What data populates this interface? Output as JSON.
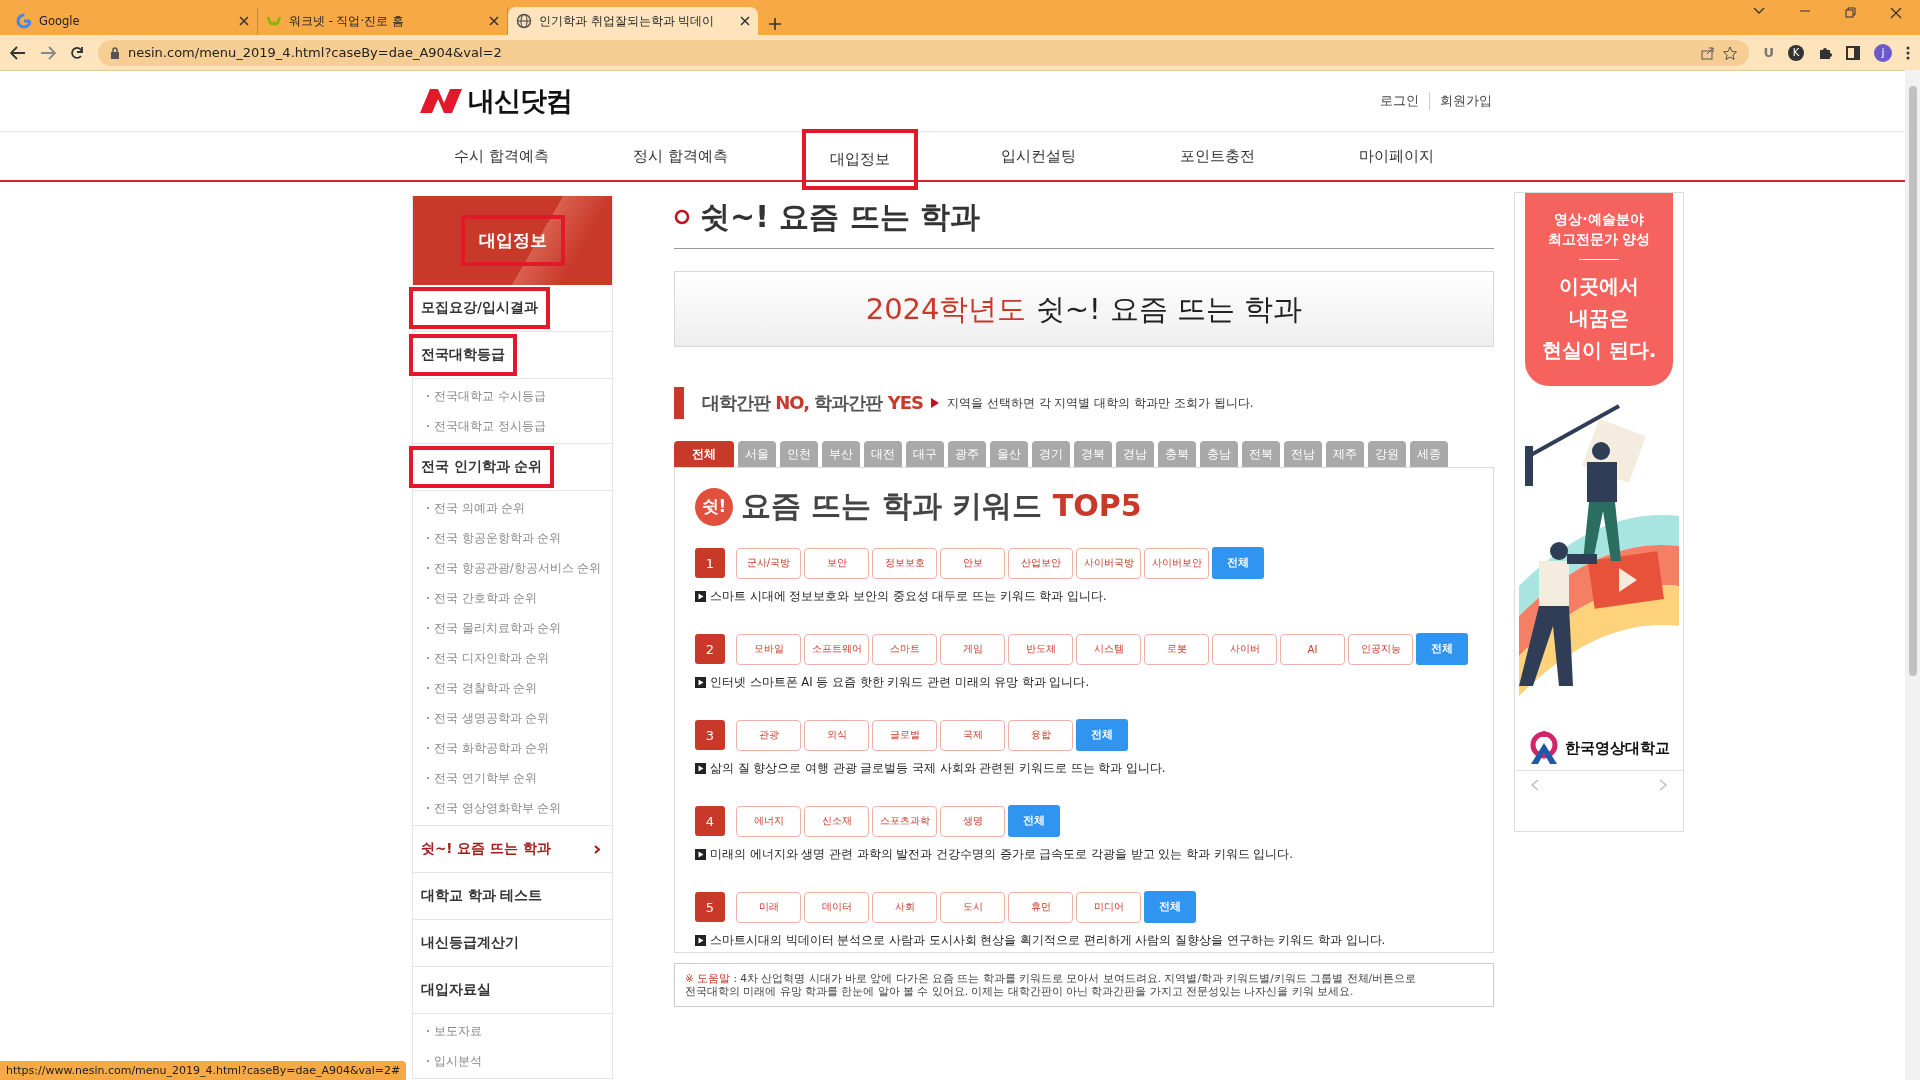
{
  "browser": {
    "tabs": [
      {
        "title": "Google",
        "kind": "google",
        "selected": false
      },
      {
        "title": "워크넷 - 직업·진로 홈",
        "kind": "leaf",
        "selected": false
      },
      {
        "title": "인기학과 취업잘되는학과 빅데이",
        "kind": "globe",
        "selected": true
      }
    ],
    "url": "nesin.com/menu_2019_4.html?caseBy=dae_A904&val=2",
    "extensions": [
      "U",
      "K"
    ],
    "profile": "j"
  },
  "header": {
    "logo": "내신닷컴",
    "links": [
      "로그인",
      "회원가입"
    ],
    "nav": [
      {
        "label": "수시 합격예측",
        "highlighted": false
      },
      {
        "label": "정시 합격예측",
        "highlighted": false
      },
      {
        "label": "대입정보",
        "highlighted": true
      },
      {
        "label": "입시컨설팅",
        "highlighted": false
      },
      {
        "label": "포인트충전",
        "highlighted": false
      },
      {
        "label": "마이페이지",
        "highlighted": false
      }
    ]
  },
  "sidebar": {
    "title": "대입정보",
    "title_highlighted": true,
    "items": [
      {
        "kind": "main",
        "label": "모집요강/입시결과",
        "highlighted": true,
        "selected": false
      },
      {
        "kind": "main",
        "label": "전국대학등급",
        "highlighted": true,
        "selected": false,
        "children": [
          {
            "label": "전국대학교 수시등급"
          },
          {
            "label": "전국대학교 정시등급"
          }
        ]
      },
      {
        "kind": "main",
        "label": "전국 인기학과 순위",
        "highlighted": true,
        "selected": false,
        "children": [
          {
            "label": "전국 의예과 순위"
          },
          {
            "label": "전국 항공운항학과 순위"
          },
          {
            "label": "전국 항공관광/항공서비스 순위"
          },
          {
            "label": "전국 간호학과 순위"
          },
          {
            "label": "전국 물리치료학과 순위"
          },
          {
            "label": "전국 디자인학과 순위"
          },
          {
            "label": "전국 경찰학과 순위"
          },
          {
            "label": "전국 생명공학과 순위"
          },
          {
            "label": "전국 화학공학과 순위"
          },
          {
            "label": "전국 연기학부 순위"
          },
          {
            "label": "전국 영상영화학부 순위"
          }
        ]
      },
      {
        "kind": "main",
        "label": "쉿~! 요즘 뜨는 학과",
        "highlighted": false,
        "selected": true
      },
      {
        "kind": "main",
        "label": "대학교 학과 테스트",
        "highlighted": false,
        "selected": false
      },
      {
        "kind": "main",
        "label": "내신등급계산기",
        "highlighted": false,
        "selected": false
      },
      {
        "kind": "main",
        "label": "대입자료실",
        "highlighted": false,
        "selected": false,
        "children": [
          {
            "label": "보도자료"
          },
          {
            "label": "입시분석"
          }
        ]
      }
    ]
  },
  "main": {
    "title": "쉿~! 요즘 뜨는 학과",
    "banner": {
      "year": "2024학년도",
      "text": "쉿~! 요즘 뜨는 학과"
    },
    "slogan": [
      {
        "text": "대학간판 ",
        "accent": false
      },
      {
        "text": "NO,",
        "accent": true
      },
      {
        "text": " 학과간판 ",
        "accent": false
      },
      {
        "text": "YES",
        "accent": true
      }
    ],
    "slogan_hint": "지역을 선택하면 각 지역별 대학의 학과만 조회가 됩니다.",
    "regions": [
      {
        "label": "전체",
        "selected": true
      },
      {
        "label": "서울",
        "selected": false
      },
      {
        "label": "인천",
        "selected": false
      },
      {
        "label": "부산",
        "selected": false
      },
      {
        "label": "대전",
        "selected": false
      },
      {
        "label": "대구",
        "selected": false
      },
      {
        "label": "광주",
        "selected": false
      },
      {
        "label": "울산",
        "selected": false
      },
      {
        "label": "경기",
        "selected": false
      },
      {
        "label": "경북",
        "selected": false
      },
      {
        "label": "경남",
        "selected": false
      },
      {
        "label": "충북",
        "selected": false
      },
      {
        "label": "충남",
        "selected": false
      },
      {
        "label": "전북",
        "selected": false
      },
      {
        "label": "전남",
        "selected": false
      },
      {
        "label": "제주",
        "selected": false
      },
      {
        "label": "강원",
        "selected": false
      },
      {
        "label": "세종",
        "selected": false
      }
    ],
    "keyword_title": {
      "badge": "쉿!",
      "text": "요즘 뜨는 학과 키워드",
      "accent": "TOP5"
    },
    "groups": [
      {
        "rank": "1",
        "keywords": [
          "군사/국방",
          "보안",
          "정보보호",
          "안보",
          "산업보안",
          "사이버국방",
          "사이버보안"
        ],
        "all_label": "전체",
        "description": "스마트 시대에 정보보호와 보안의 중요성 대두로 뜨는 키워드 학과 입니다."
      },
      {
        "rank": "2",
        "keywords": [
          "모바일",
          "소프트웨어",
          "스마트",
          "게임",
          "반도체",
          "시스템",
          "로봇",
          "사이버",
          "AI",
          "인공지능"
        ],
        "all_label": "전체",
        "description": "인터넷 스마트폰 AI 등 요즘 핫한 키워드 관련 미래의 유망 학과 입니다."
      },
      {
        "rank": "3",
        "keywords": [
          "관광",
          "외식",
          "글로벌",
          "국제",
          "융합"
        ],
        "all_label": "전체",
        "description": "삶의 질 향상으로 여행 관광 글로벌등 국제 사회와 관련된 키워드로 뜨는 학과 입니다."
      },
      {
        "rank": "4",
        "keywords": [
          "에너지",
          "신소재",
          "스포츠과학",
          "생명"
        ],
        "all_label": "전체",
        "description": "미래의 에너지와 생명 관련 과학의 발전과 건강수명의 증가로 급속도로 각광을 받고 있는 학과 키워드 입니다."
      },
      {
        "rank": "5",
        "keywords": [
          "미래",
          "데이터",
          "사회",
          "도시",
          "휴먼",
          "미디어"
        ],
        "all_label": "전체",
        "description": "스마트시대의 빅데이터 분석으로 사람과 도시사회 현상을 획기적으로 편리하게 사람의 질향상을 연구하는 키워드 학과 입니다."
      }
    ],
    "note": {
      "label": "※ 도움말",
      "lines": [
        ": 4차 산업혁명 시대가 바로 앞에 다가온 요즘 뜨는 학과를 키워드로 모아서 보여드려요. 지역별/학과 키워드별/키워드 그룹별 전체/버튼으로",
        "전국대학의 미래에 유망 학과를 한눈에 알아 볼 수 있어요. 이제는 대학간판이 아닌 학과간판을 가지고 전문성있는 나자신을 키워 보세요."
      ]
    }
  },
  "ad": {
    "lines": [
      "영상·예술분야",
      "최고전문가 양성"
    ],
    "headline": [
      "이곳에서",
      "내꿈은",
      "현실이 된다."
    ],
    "picture": {
      "kind": "picture"
    },
    "school": "한국영상대학교"
  },
  "status_url": "https://www.nesin.com/menu_2019_4.html?caseBy=dae_A904&val=2#"
}
